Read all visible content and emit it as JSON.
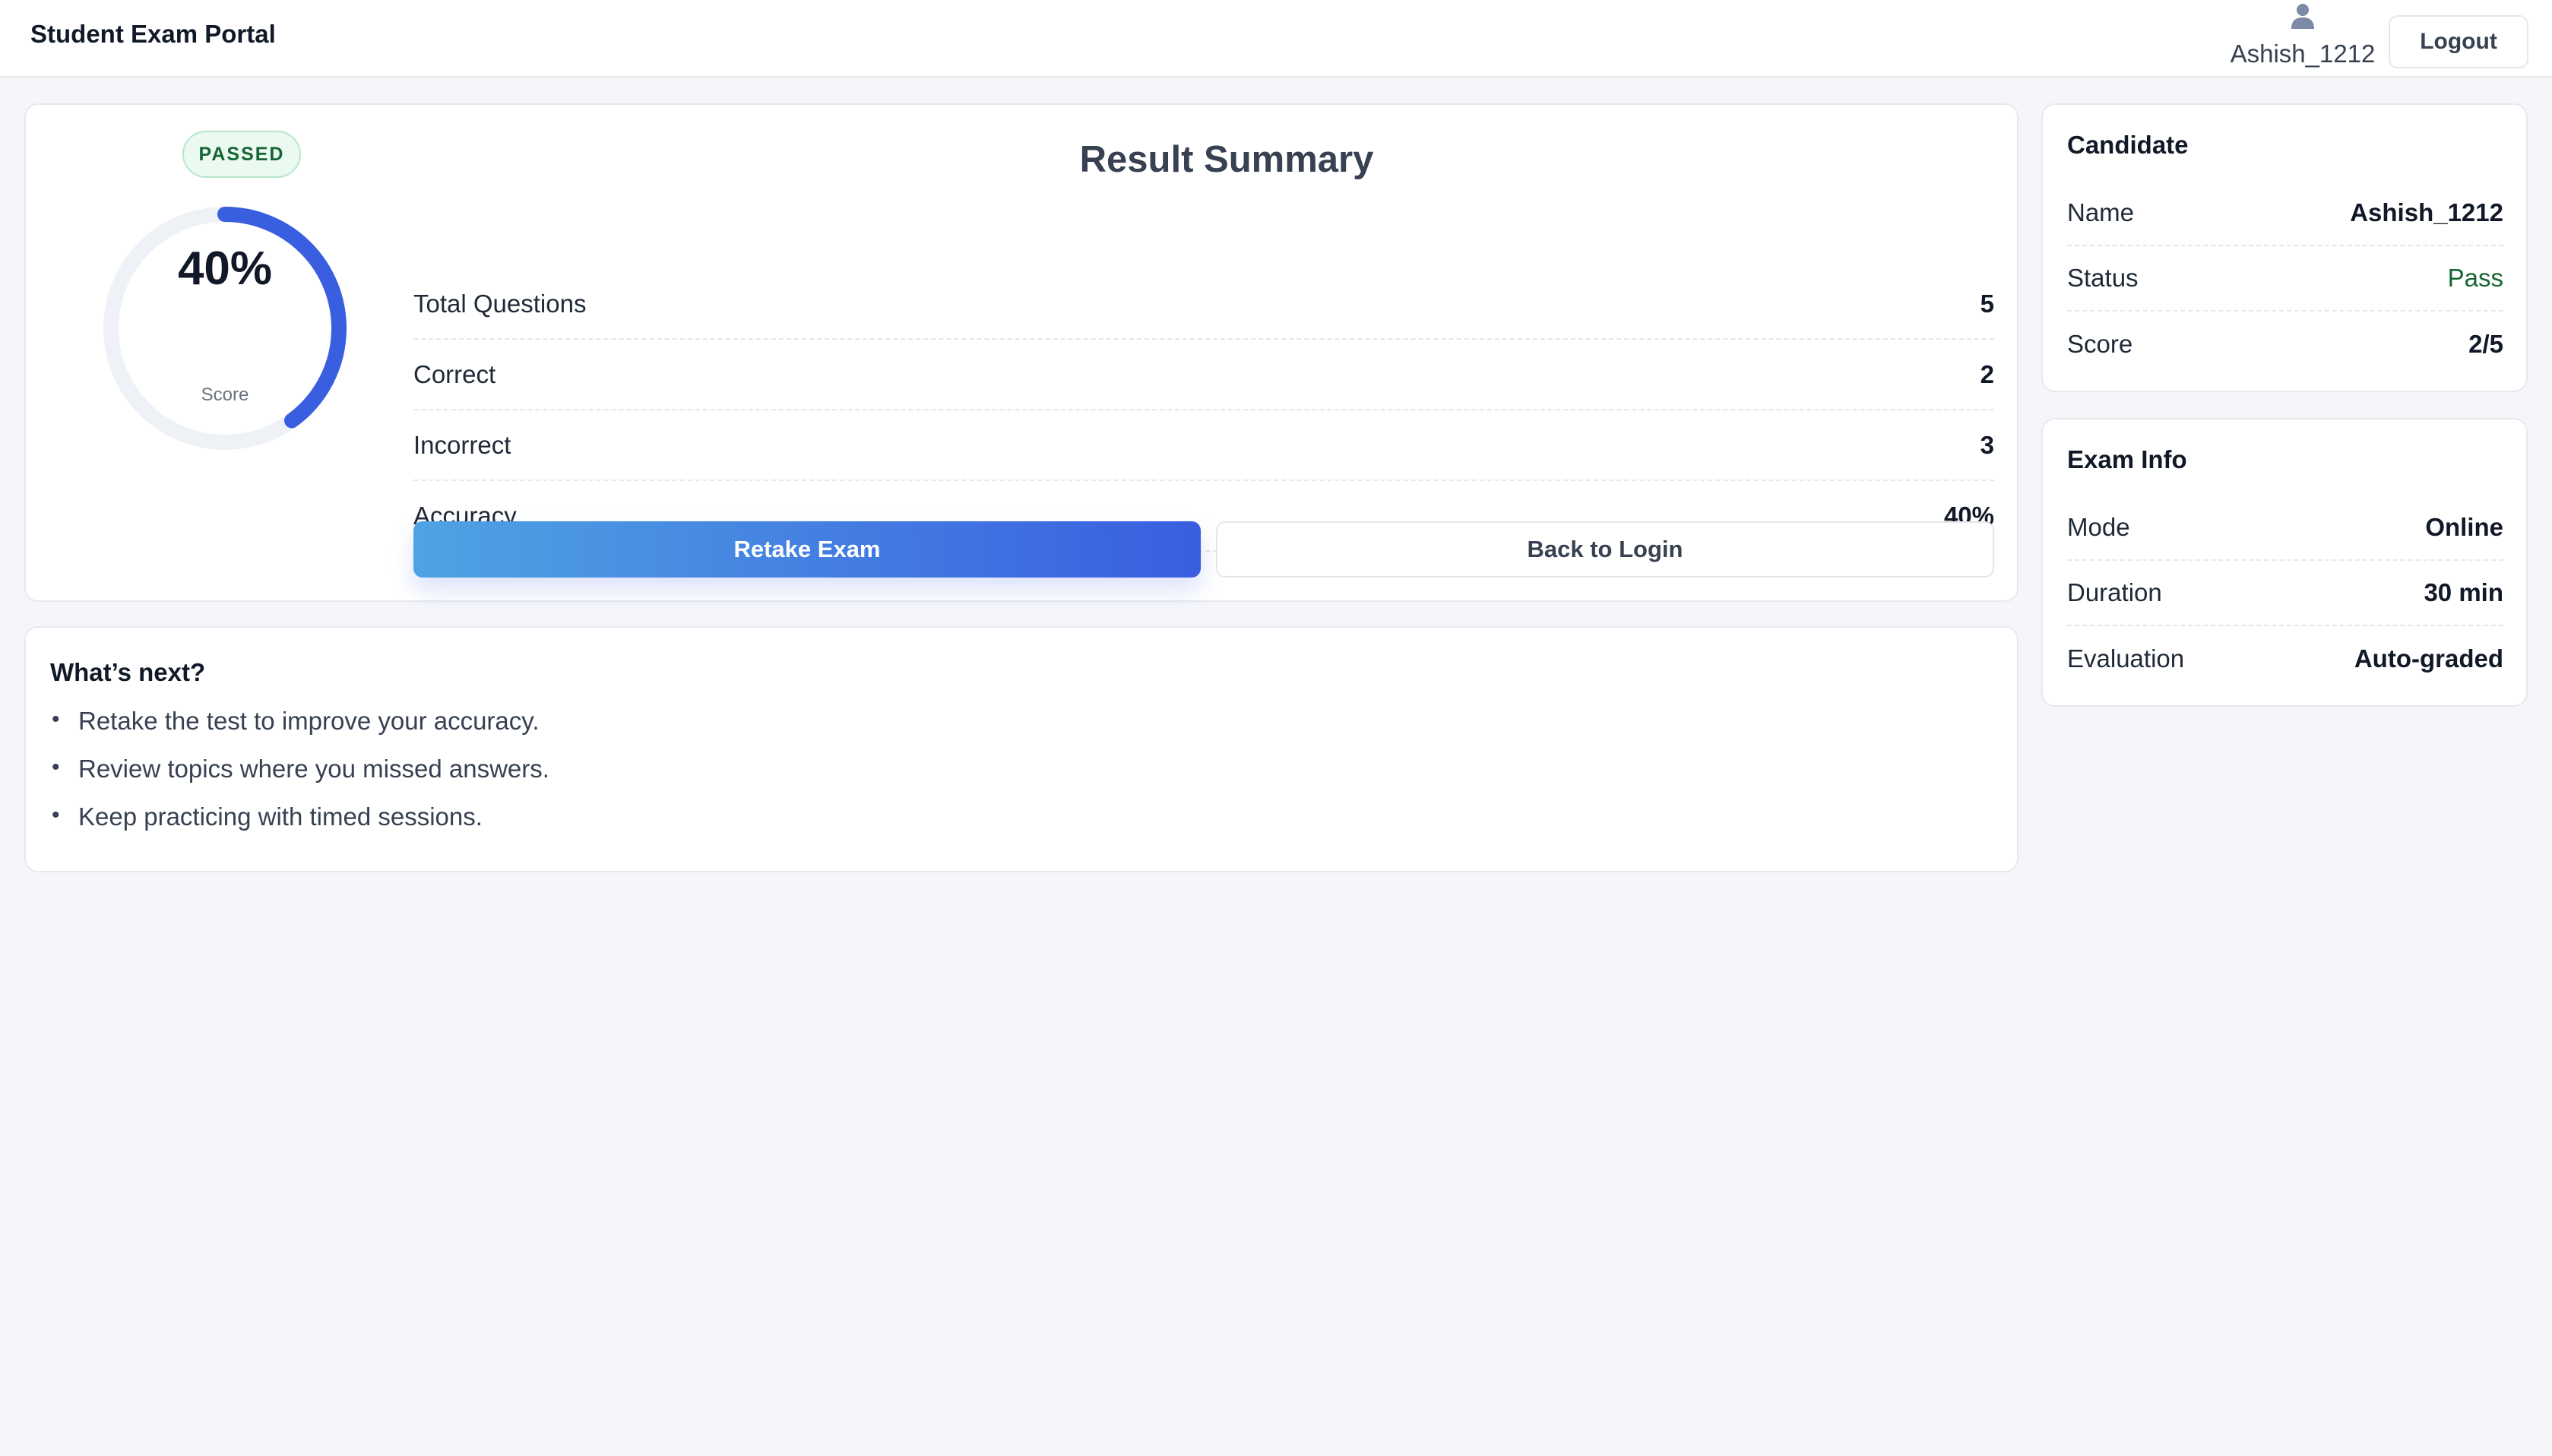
{
  "header": {
    "app_title": "Student Exam Portal",
    "username": "Ashish_1212",
    "user_icon": "user-icon",
    "logout_label": "Logout"
  },
  "result": {
    "badge": "PASSED",
    "score_percent": 40,
    "score_text": "40%",
    "score_label": "Score",
    "title": "Result Summary",
    "stats": [
      {
        "label": "Total Questions",
        "value": "5"
      },
      {
        "label": "Correct",
        "value": "2"
      },
      {
        "label": "Incorrect",
        "value": "3"
      },
      {
        "label": "Accuracy",
        "value": "40%"
      }
    ],
    "retake_label": "Retake Exam",
    "back_label": "Back to Login"
  },
  "next": {
    "title": "What’s next?",
    "items": [
      "Retake the test to improve your accuracy.",
      "Review topics where you missed answers.",
      "Keep practicing with timed sessions."
    ]
  },
  "candidate": {
    "title": "Candidate",
    "rows": [
      {
        "label": "Name",
        "value": "Ashish_1212"
      },
      {
        "label": "Status",
        "value": "Pass"
      },
      {
        "label": "Score",
        "value": "2/5"
      }
    ]
  },
  "exam_info": {
    "title": "Exam Info",
    "rows": [
      {
        "label": "Mode",
        "value": "Online"
      },
      {
        "label": "Duration",
        "value": "30 min"
      },
      {
        "label": "Evaluation",
        "value": "Auto-graded"
      }
    ]
  },
  "colors": {
    "accent": "#3a5ee0",
    "accent_light": "#4fa3e3",
    "pass": "#166534",
    "gauge_track": "#eef1f6"
  }
}
